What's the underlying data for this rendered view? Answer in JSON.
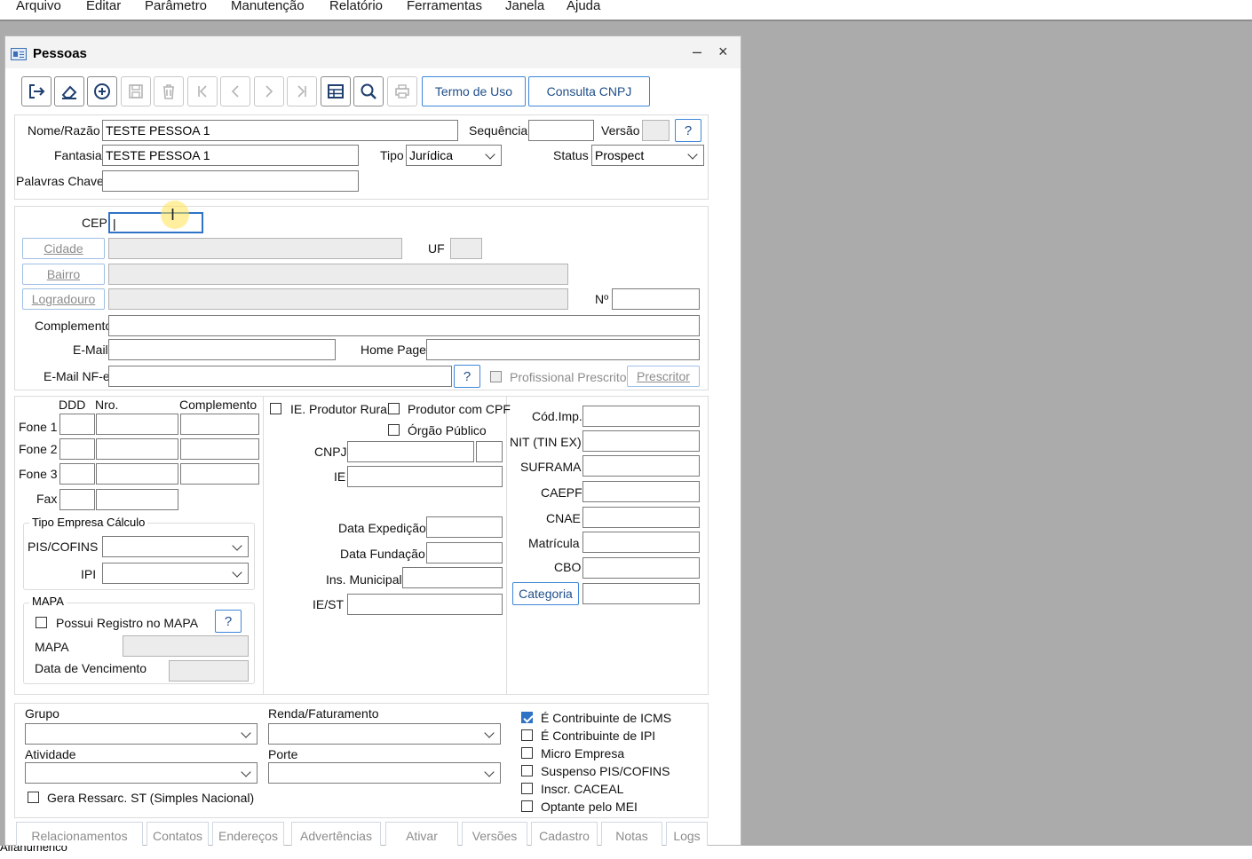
{
  "menubar": {
    "items": [
      "Arquivo",
      "Editar",
      "Parâmetro",
      "Manutenção",
      "Relatório",
      "Ferramentas",
      "Janela",
      "Ajuda"
    ]
  },
  "window": {
    "title": "Pessoas",
    "minimize": "–",
    "close": "×"
  },
  "toolbar": {
    "termo_label": "Termo de Uso",
    "cnpj_label": "Consulta CNPJ"
  },
  "header": {
    "nome_label": "Nome/Razão",
    "nome_value": "TESTE PESSOA 1",
    "sequencia_label": "Sequência",
    "sequencia_value": "",
    "versao_label": "Versão",
    "versao_value": "",
    "help": "?",
    "fantasia_label": "Fantasia",
    "fantasia_value": "TESTE PESSOA 1",
    "tipo_label": "Tipo",
    "tipo_value": "Jurídica",
    "status_label": "Status",
    "status_value": "Prospect",
    "palavras_label": "Palavras Chave",
    "palavras_value": ""
  },
  "address": {
    "cep_label": "CEP",
    "cep_value": "|",
    "cidade_button": "Cidade",
    "uf_label": "UF",
    "bairro_button": "Bairro",
    "logradouro_button": "Logradouro",
    "numero_label": "Nº",
    "complemento_label": "Complemento",
    "email_label": "E-Mail",
    "homepage_label": "Home Page",
    "email_nfe_label": "E-Mail NF-e",
    "help": "?",
    "prescritor_check_label": "Profissional Prescritor",
    "prescritor_button": "Prescritor"
  },
  "phones": {
    "col_ddd": "DDD",
    "col_nro": "Nro.",
    "col_complemento": "Complemento",
    "fone1": "Fone 1",
    "fone2": "Fone 2",
    "fone3": "Fone 3",
    "fax": "Fax"
  },
  "tipo_empresa": {
    "title": "Tipo Empresa Cálculo",
    "pis_label": "PIS/COFINS",
    "ipi_label": "IPI"
  },
  "mapa": {
    "title": "MAPA",
    "possui_label": "Possui Registro no MAPA",
    "help": "?",
    "mapa_label": "MAPA",
    "vencimento_label": "Data de Vencimento"
  },
  "fiscal": {
    "ie_rural_label": "IE. Produtor Rural",
    "cpf_label": "Produtor com CPF",
    "orgao_label": "Órgão Público",
    "cnpj_label": "CNPJ",
    "ie_label": "IE",
    "expedicao_label": "Data Expedição",
    "fundacao_label": "Data Fundação",
    "municipal_label": "Ins. Municipal",
    "iest_label": "IE/ST"
  },
  "codes": {
    "codimp_label": "Cód.Imp.",
    "nit_label": "NIT (TIN EX)",
    "suframa_label": "SUFRAMA",
    "caepf_label": "CAEPF",
    "cnae_label": "CNAE",
    "matricula_label": "Matrícula",
    "cbo_label": "CBO",
    "categoria_button": "Categoria"
  },
  "bottom": {
    "grupo_label": "Grupo",
    "renda_label": "Renda/Faturamento",
    "atividade_label": "Atividade",
    "porte_label": "Porte",
    "ressarc_label": "Gera Ressarc. ST (Simples Nacional)",
    "icms_label": "É Contribuinte de ICMS",
    "ipi_label": "É Contribuinte de IPI",
    "micro_label": "Micro Empresa",
    "suspenso_label": "Suspenso PIS/COFINS",
    "caceal_label": "Inscr. CACEAL",
    "mei_label": "Optante pelo MEI"
  },
  "tabs": [
    "Relacionamentos",
    "Contatos",
    "Endereços",
    "Advertências",
    "Ativar",
    "Versões",
    "Cadastro",
    "Notas",
    "Logs"
  ],
  "statusbar": {
    "text": "Alfanumerico"
  }
}
